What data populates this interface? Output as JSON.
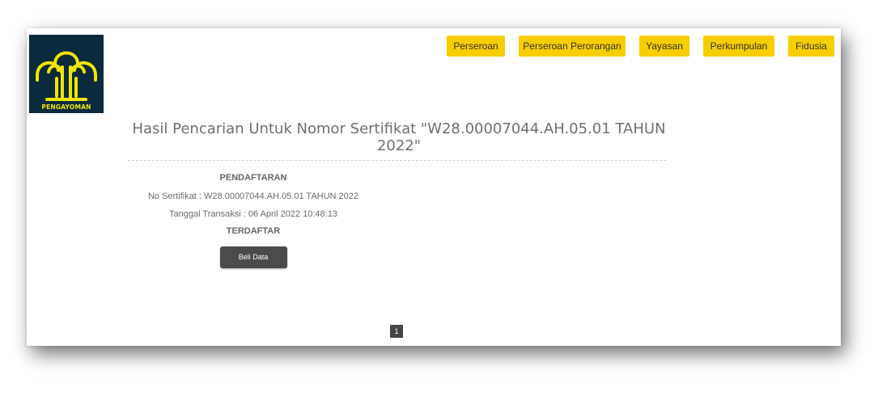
{
  "logo": {
    "text": "PENGAYOMAN",
    "bg_color": "#0b2a3d",
    "fg_color": "#f1e600"
  },
  "nav": {
    "items": [
      {
        "label": "Perseroan"
      },
      {
        "label": "Perseroan Perorangan"
      },
      {
        "label": "Yayasan"
      },
      {
        "label": "Perkumpulan"
      },
      {
        "label": "Fidusia"
      }
    ],
    "accent_color": "#f7ce00"
  },
  "search": {
    "title": "Hasil Pencarian Untuk Nomor Sertifikat \"W28.00007044.AH.05.01 TAHUN 2022\""
  },
  "result": {
    "heading": "PENDAFTARAN",
    "certificate_line": "No Sertifikat : W28.00007044.AH.05.01 TAHUN 2022",
    "transaction_line": "Tanggal Transaksi : 06 April 2022 10:48:13",
    "status": "TERDAFTAR",
    "buy_label": "Beli Data"
  },
  "pagination": {
    "current_page": "1"
  }
}
